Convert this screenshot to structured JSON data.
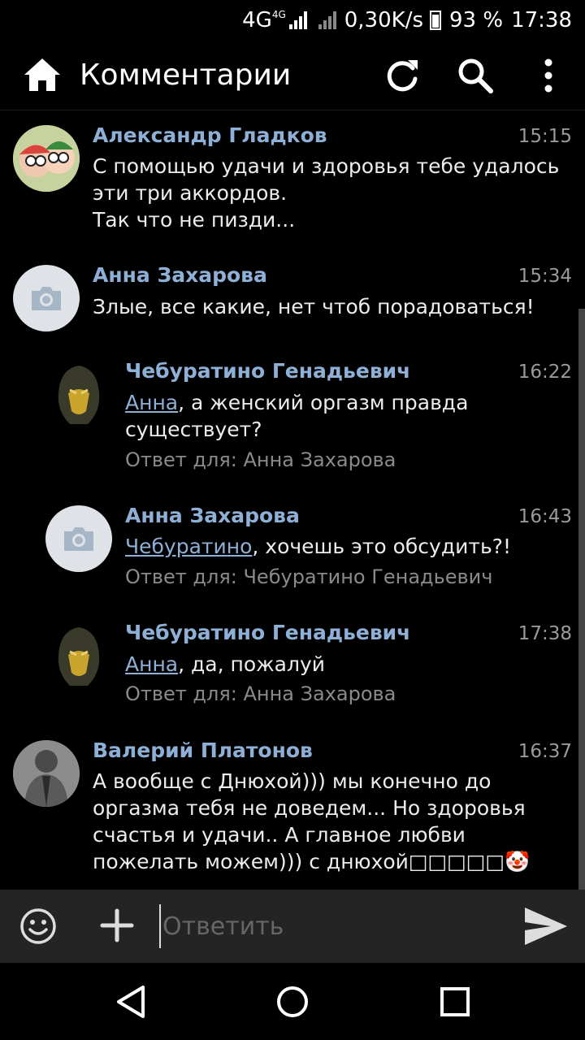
{
  "status_bar": {
    "network": "4G",
    "network_small": "4G",
    "speed": "0,30K/s",
    "battery": "93 %",
    "time": "17:38"
  },
  "app_bar": {
    "title": "Комментарии",
    "icons": [
      "home-icon",
      "refresh-icon",
      "search-icon",
      "more-vertical-icon"
    ]
  },
  "comments": [
    {
      "author": "Александр Гладков",
      "time": "15:15",
      "avatar": "photo",
      "text": "С помощью удачи и здоровья тебе удалось эти три аккордов.\nТак что не пизди..."
    },
    {
      "author": "Анна Захарова",
      "time": "15:34",
      "avatar": "camera-placeholder",
      "text": "Злые, все какие, нет чтоб порадоваться!"
    },
    {
      "author": "Чебуратино Генадьевич",
      "time": "16:22",
      "avatar": "photo",
      "mention": "Анна",
      "text": ", а женский оргазм правда существует?",
      "reply_to": "Ответ для: Анна Захарова"
    },
    {
      "author": "Анна Захарова",
      "time": "16:43",
      "avatar": "camera-placeholder",
      "mention": "Чебуратино",
      "text": ", хочешь это обсудить?!",
      "reply_to": "Ответ для: Чебуратино Генадьевич"
    },
    {
      "author": "Чебуратино Генадьевич",
      "time": "17:38",
      "avatar": "photo",
      "mention": "Анна",
      "text": ", да, пожалуй",
      "reply_to": "Ответ для: Анна Захарова"
    },
    {
      "author": "Валерий Платонов",
      "time": "16:37",
      "avatar": "photo",
      "text": "А вообще с Днюхой))) мы конечно до оргазма тебя не доведем... Но здоровья счастья и удачи.. А главное любви пожелать можем))) с днюхой□□□□□🤡"
    }
  ],
  "input": {
    "placeholder": "Ответить",
    "value": ""
  },
  "colors": {
    "accent": "#8fb0d6",
    "background": "#000000",
    "input_bar": "#242424"
  }
}
